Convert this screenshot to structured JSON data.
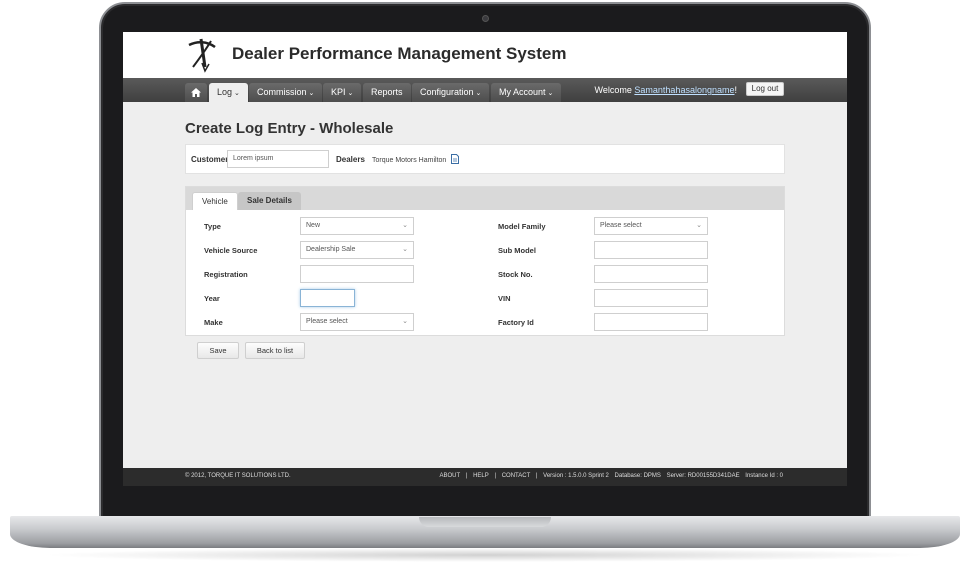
{
  "app": {
    "title": "Dealer Performance Management System"
  },
  "nav": {
    "items": [
      {
        "label": "Log",
        "has_dropdown": true,
        "active": true
      },
      {
        "label": "Commission",
        "has_dropdown": true
      },
      {
        "label": "KPI",
        "has_dropdown": true
      },
      {
        "label": "Reports",
        "has_dropdown": false
      },
      {
        "label": "Configuration",
        "has_dropdown": true
      },
      {
        "label": "My Account",
        "has_dropdown": true
      }
    ],
    "welcome_prefix": "Welcome ",
    "username": "Samanthahasalongname",
    "welcome_suffix": "!",
    "logout_label": "Log out"
  },
  "page": {
    "title": "Create Log Entry - Wholesale"
  },
  "customer_bar": {
    "customer_label": "Customer",
    "customer_value": "Lorem ipsum",
    "dealers_label": "Dealers",
    "dealers_value": "Torque Motors Hamilton"
  },
  "tabs": [
    {
      "label": "Vehicle",
      "active": true
    },
    {
      "label": "Sale Details",
      "active": false
    }
  ],
  "form": {
    "left": [
      {
        "label": "Type",
        "value": "New",
        "kind": "select"
      },
      {
        "label": "Vehicle Source",
        "value": "Dealership Sale",
        "kind": "select"
      },
      {
        "label": "Registration",
        "value": "",
        "kind": "text"
      },
      {
        "label": "Year",
        "value": "",
        "kind": "text"
      },
      {
        "label": "Make",
        "value": "Please select",
        "kind": "select"
      }
    ],
    "right": [
      {
        "label": "Model Family",
        "value": "Please select",
        "kind": "select"
      },
      {
        "label": "Sub Model",
        "value": "",
        "kind": "text"
      },
      {
        "label": "Stock No.",
        "value": "",
        "kind": "text"
      },
      {
        "label": "VIN",
        "value": "",
        "kind": "text"
      },
      {
        "label": "Factory Id",
        "value": "",
        "kind": "text"
      }
    ]
  },
  "actions": {
    "save_label": "Save",
    "back_label": "Back to list"
  },
  "footer": {
    "copyright": "© 2012, TORQUE IT SOLUTIONS LTD.",
    "about": "ABOUT",
    "help": "HELP",
    "contact": "CONTACT",
    "version": "Version : 1.5.0.0 Sprint 2",
    "database": "Database: DPMS",
    "server": "Server: RD00155D341DAE",
    "instance": "Instance Id : 0",
    "separator": "|"
  },
  "icons": {
    "home": "home-icon",
    "dropdown": "chevron-down-icon",
    "document": "document-icon",
    "logo": "brand-logo"
  },
  "colors": {
    "navbar": "#4a4a4a",
    "footer": "#2c2c2c",
    "link": "#bfe0ff",
    "focus_border": "#8ab4d6"
  }
}
